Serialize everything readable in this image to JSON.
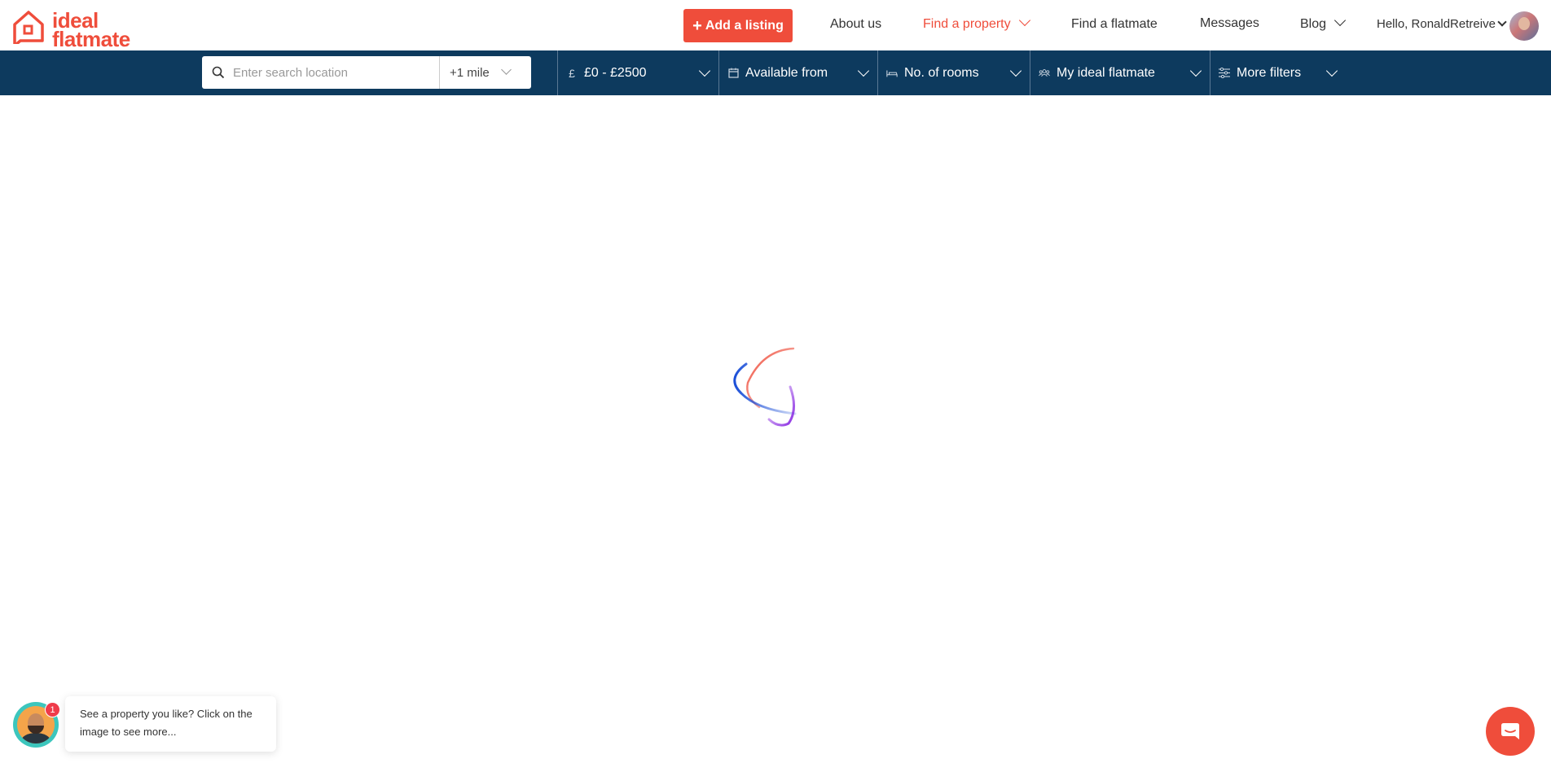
{
  "brand": {
    "line1": "ideal",
    "line2": "flatmate",
    "color": "#ef4d3b"
  },
  "header": {
    "add_listing_label": "Add a listing",
    "nav": {
      "about": "About us",
      "find_property": "Find a property",
      "find_flatmate": "Find a flatmate",
      "messages": "Messages",
      "blog": "Blog",
      "greeting": "Hello, RonaldRetreive"
    }
  },
  "filters": {
    "search": {
      "placeholder": "Enter search location",
      "value": ""
    },
    "radius": "+1 mile",
    "price": "£0 - £2500",
    "available_from": "Available from",
    "rooms": "No. of rooms",
    "ideal_flatmate": "My ideal flatmate",
    "more_filters": "More filters"
  },
  "chat": {
    "badge_count": "1",
    "message": "See a property you like? Click on the image to see more..."
  },
  "colors": {
    "accent": "#ef4d3b",
    "filterbar": "#0d3a5e",
    "active_nav": "#ef4d3b"
  },
  "icons": {
    "search": "search-icon",
    "pound": "pound-icon",
    "calendar": "calendar-icon",
    "bed": "bed-icon",
    "people": "people-icon",
    "sliders": "sliders-icon",
    "messenger": "chat-icon"
  }
}
